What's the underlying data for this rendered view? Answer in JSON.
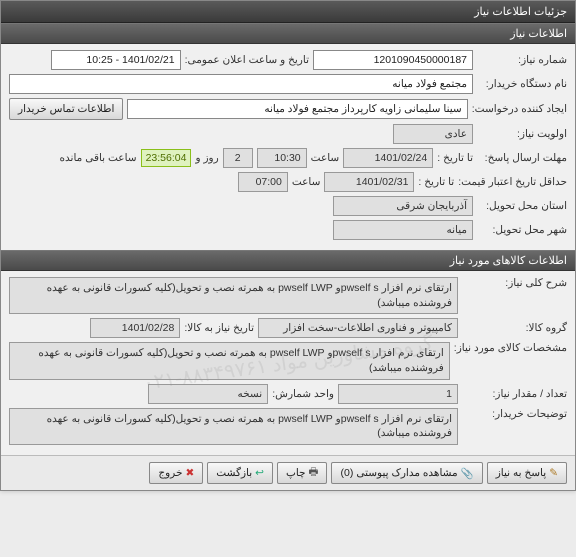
{
  "window_title": "جزئیات اطلاعات نیاز",
  "section1_title": "اطلاعات نیاز",
  "section2_title": "اطلاعات کالاهای مورد نیاز",
  "fields": {
    "need_no_label": "شماره نیاز:",
    "need_no": "1201090450000187",
    "public_announce_label": "تاریخ و ساعت اعلان عمومی:",
    "public_announce": "1401/02/21 - 10:25",
    "buyer_org_label": "نام دستگاه خریدار:",
    "buyer_org": "مجتمع فولاد میانه",
    "creator_label": "ایجاد کننده درخواست:",
    "creator": "سینا سلیمانی زاویه کارپرداز مجتمع فولاد میانه",
    "contact_btn": "اطلاعات تماس خریدار",
    "priority_label": "اولویت نیاز:",
    "priority": "عادی",
    "reply_deadline_label": "مهلت ارسال پاسخ:",
    "until_label": "تا تاریخ :",
    "reply_date": "1401/02/24",
    "time_label": "ساعت",
    "reply_time": "10:30",
    "days_count": "2",
    "days_and_label": "روز و",
    "remaining_time": "23:56:04",
    "remaining_label": "ساعت باقی مانده",
    "price_validity_label": "حداقل تاریخ اعتبار قیمت:",
    "price_valid_date": "1401/02/31",
    "price_valid_time": "07:00",
    "delivery_province_label": "استان محل تحویل:",
    "delivery_province": "آذربایجان شرقی",
    "delivery_city_label": "شهر محل تحویل:",
    "delivery_city": "میانه"
  },
  "goods": {
    "item_desc_label": "شرح کلی نیاز:",
    "item_desc": "ارتقای نرم افزار pwself sو pwself LWP به همرته نصب و تحویل(کلیه کسورات قانونی به عهده فروشنده میباشد)",
    "group_label": "گروه کالا:",
    "group": "کامپیوتر و فناوری اطلاعات-سخت افزار",
    "need_item_date_label": "تاریخ نیاز به کالا:",
    "need_item_date": "1401/02/28",
    "spec_label": "مشخصات کالای مورد نیاز:",
    "spec": "ارتقای نرم افزار pwself sو pwself LWP به همرته نصب و تحویل(کلیه کسورات قانونی به عهده فروشنده میباشد)",
    "qty_label": "تعداد / مقدار نیاز:",
    "qty": "1",
    "unit_label": "واحد شمارش:",
    "unit": "نسخه",
    "buyer_notes_label": "توضیحات خریدار:",
    "buyer_notes": "ارتقای نرم افزار pwself sو pwself LWP به همرته نصب و تحویل(کلیه کسورات قانونی به عهده فروشنده میباشد)"
  },
  "buttons": {
    "reply_need": "پاسخ به نیاز",
    "view_attach": "مشاهده مدارک پیوستی",
    "attach_count": "(0)",
    "print": "چاپ",
    "back": "بازگشت",
    "exit": "خروج"
  },
  "watermark": "گروه مشاورین مواد ۸۸۳۴۹۷۶۱-۰۲۱"
}
